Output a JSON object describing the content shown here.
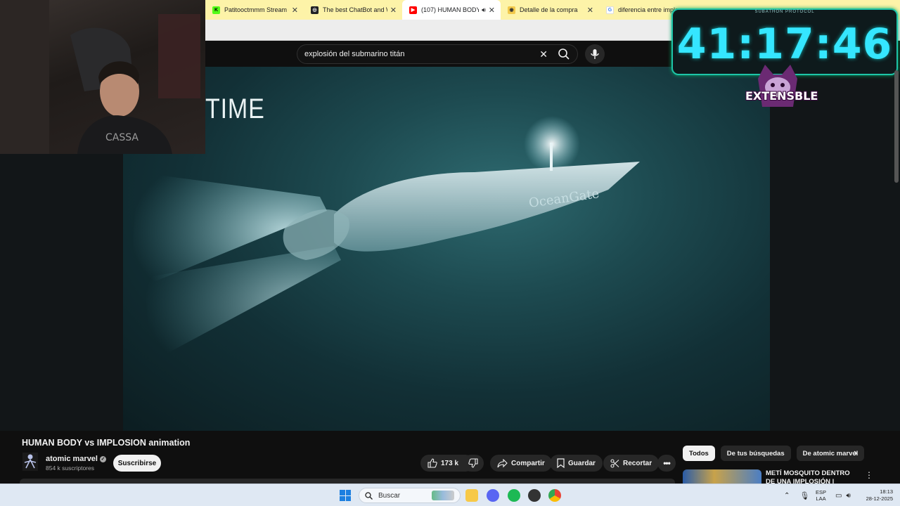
{
  "browser": {
    "tabs": [
      {
        "title": "Patitooctmmm Stream - V",
        "favicon_color": "#53fc18"
      },
      {
        "title": "The best ChatBot and W",
        "favicon_color": "#202124"
      },
      {
        "title": "(107) HUMAN BODY",
        "favicon_color": "#ff0000",
        "active": true
      },
      {
        "title": "Detalle de la compra",
        "favicon_color": "#f2c94c"
      },
      {
        "title": "diferencia entre implo",
        "favicon_color": "#4285f4"
      }
    ]
  },
  "youtube": {
    "search": {
      "query": "explosión del submarino titán"
    },
    "video": {
      "overlay_text": "TIME",
      "title": "HUMAN BODY vs IMPLOSION animation",
      "sub_brand": "OceanGate"
    },
    "channel": {
      "name": "atomic marvel",
      "subscribers": "854 k suscriptores"
    },
    "actions": {
      "subscribe": "Suscribirse",
      "likes": "173 k",
      "share": "Compartir",
      "save": "Guardar",
      "clip": "Recortar"
    },
    "sidebar": {
      "chips": [
        "Todos",
        "De tus búsquedas",
        "De atomic marvel"
      ],
      "recommended_title": "METÍ MOSQUITO DENTRO DE UNA IMPLOSIÓN | OceanGate"
    }
  },
  "stream_overlay": {
    "timer_label": "SUBATHON PROTOCOL",
    "timer": "41:17:46",
    "brand": "EXTENSBLE"
  },
  "taskbar": {
    "search_placeholder": "Buscar",
    "language": "ESP",
    "layout": "LAA",
    "time": "18:13",
    "date": "28-12-2025"
  }
}
